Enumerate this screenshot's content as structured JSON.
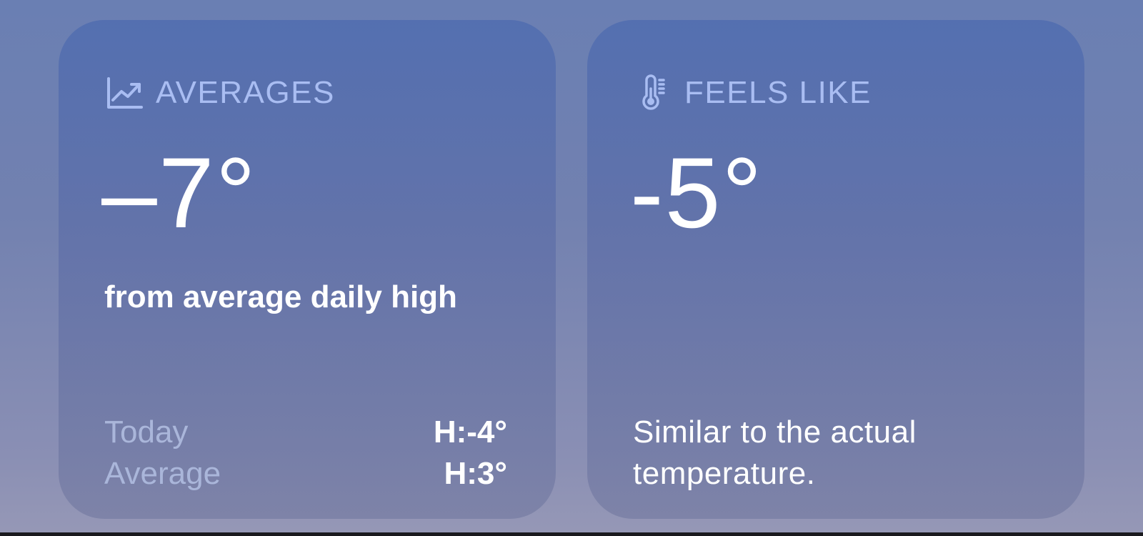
{
  "colors": {
    "card_title": "#a9bdf2",
    "muted_label": "#aab6da",
    "value_text": "#ffffff",
    "background": "#7281b0"
  },
  "averages": {
    "icon": "chart-line-uptrend-icon",
    "title": "AVERAGES",
    "value": "–7°",
    "subtitle": "from average daily high",
    "rows": [
      {
        "label": "Today",
        "value": "H:-4°"
      },
      {
        "label": "Average",
        "value": "H:3°"
      }
    ]
  },
  "feels_like": {
    "icon": "thermometer-icon",
    "title": "FEELS LIKE",
    "value": "-5°",
    "description": "Similar to the actual temperature."
  }
}
